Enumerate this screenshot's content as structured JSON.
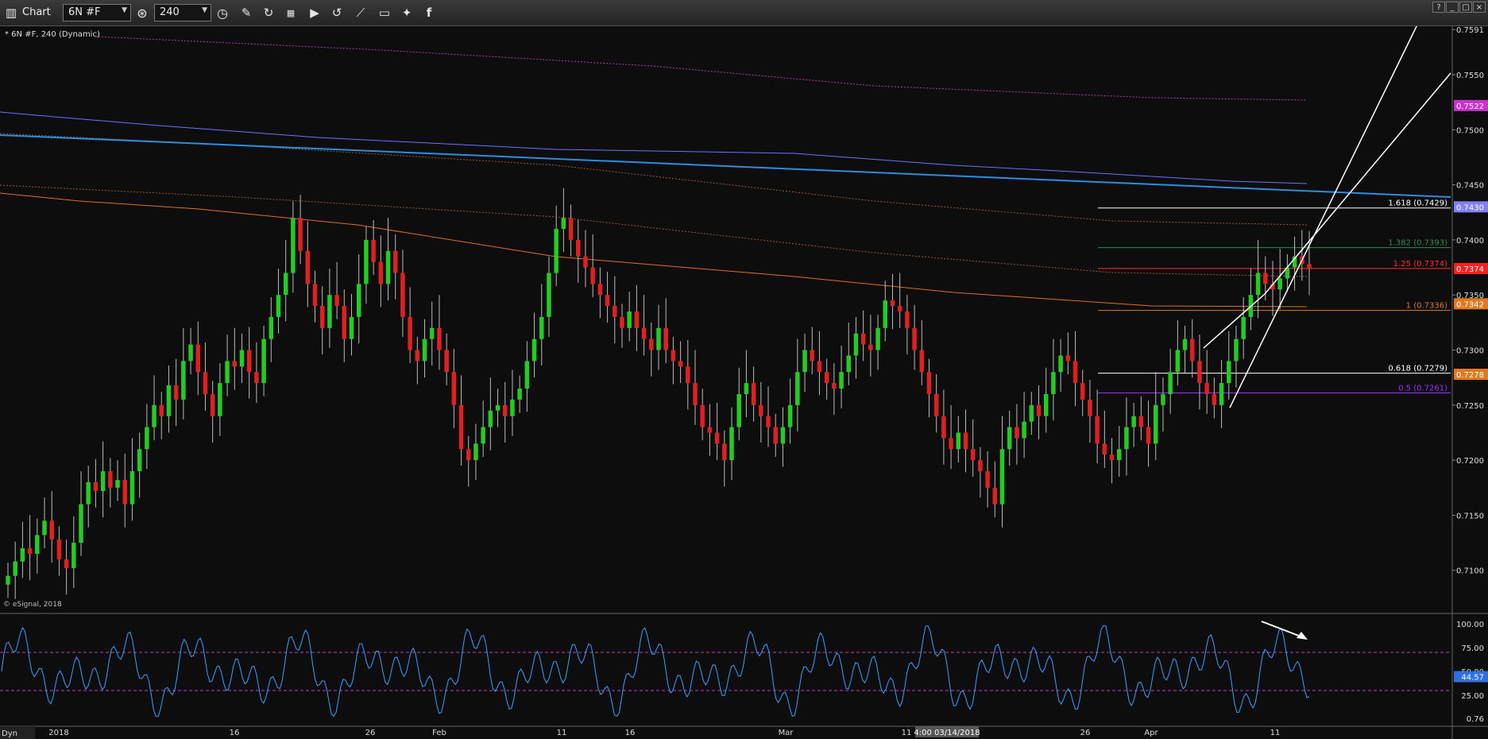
{
  "toolbar": {
    "title": "Chart",
    "symbol": "6N #F",
    "interval": "240",
    "icons": [
      "chart-app-icon",
      "symbol-lookup-icon",
      "interval-clock-icon",
      "draw-pen-icon",
      "refresh-icon",
      "settings-icon",
      "play-icon",
      "replay-icon",
      "ruler-icon",
      "comment-icon",
      "twitter-icon",
      "facebook-icon"
    ],
    "window_buttons": [
      "?",
      "_",
      "□",
      "×"
    ]
  },
  "chart_data": [
    {
      "type": "line",
      "label": "* 6N #F, 240 (Dynamic)",
      "series_name": "6N #F",
      "interval": "240",
      "copyright": "© eSignal, 2018",
      "y_ticks": [
        0.7591,
        0.755,
        0.75,
        0.745,
        0.74,
        0.735,
        0.73,
        0.725,
        0.72,
        0.715,
        0.71
      ],
      "y_tick_labels": [
        "0.7591",
        "0.7550",
        "0.7500",
        "0.7450",
        "0.7400",
        "0.7350",
        "0.7300",
        "0.7250",
        "0.7200",
        "0.7150",
        "0.7100"
      ],
      "ylim": [
        0.7063,
        0.7594
      ],
      "price_badges": [
        {
          "label": "0.7522",
          "color": "#cc33cc"
        },
        {
          "label": "0.7430",
          "color": "#8080ff"
        },
        {
          "label": "0.7374",
          "color": "#ff2020"
        },
        {
          "label": "0.7342",
          "color": "#e07a20"
        },
        {
          "label": "0.7278",
          "color": "#e07a20"
        }
      ],
      "fib_levels": [
        {
          "label": "1.618 (0.7429)",
          "value": 0.7429,
          "color": "#ffffff"
        },
        {
          "label": "1.382 (0.7393)",
          "value": 0.7393,
          "color": "#2e8b57"
        },
        {
          "label": "1.25 (0.7374)",
          "value": 0.7374,
          "color": "#ff3030"
        },
        {
          "label": "1 (0.7336)",
          "value": 0.7336,
          "color": "#e07a20"
        },
        {
          "label": "0.618 (0.7279)",
          "value": 0.7279,
          "color": "#ffffff"
        },
        {
          "label": "0.5 (0.7261)",
          "value": 0.7261,
          "color": "#9933ff"
        }
      ],
      "closes": [
        0.7095,
        0.7108,
        0.712,
        0.7115,
        0.7132,
        0.7145,
        0.7128,
        0.711,
        0.7102,
        0.7125,
        0.716,
        0.718,
        0.7172,
        0.719,
        0.7175,
        0.7182,
        0.716,
        0.719,
        0.721,
        0.723,
        0.725,
        0.724,
        0.7268,
        0.7255,
        0.729,
        0.7305,
        0.728,
        0.726,
        0.724,
        0.727,
        0.729,
        0.7285,
        0.73,
        0.728,
        0.727,
        0.731,
        0.733,
        0.735,
        0.737,
        0.742,
        0.739,
        0.736,
        0.734,
        0.732,
        0.735,
        0.734,
        0.731,
        0.733,
        0.736,
        0.74,
        0.738,
        0.736,
        0.739,
        0.737,
        0.733,
        0.73,
        0.729,
        0.731,
        0.732,
        0.73,
        0.728,
        0.725,
        0.721,
        0.72,
        0.7215,
        0.723,
        0.7245,
        0.725,
        0.724,
        0.7255,
        0.7265,
        0.729,
        0.731,
        0.733,
        0.737,
        0.741,
        0.742,
        0.74,
        0.7385,
        0.7375,
        0.736,
        0.735,
        0.734,
        0.733,
        0.732,
        0.7335,
        0.732,
        0.731,
        0.73,
        0.732,
        0.73,
        0.729,
        0.7285,
        0.727,
        0.725,
        0.723,
        0.7225,
        0.7215,
        0.72,
        0.723,
        0.726,
        0.727,
        0.725,
        0.724,
        0.723,
        0.7215,
        0.723,
        0.725,
        0.728,
        0.73,
        0.729,
        0.728,
        0.727,
        0.7265,
        0.728,
        0.7295,
        0.7315,
        0.7305,
        0.73,
        0.732,
        0.7345,
        0.734,
        0.7335,
        0.732,
        0.73,
        0.728,
        0.726,
        0.724,
        0.722,
        0.721,
        0.7225,
        0.721,
        0.72,
        0.719,
        0.7175,
        0.716,
        0.721,
        0.723,
        0.722,
        0.7235,
        0.725,
        0.724,
        0.726,
        0.728,
        0.7295,
        0.729,
        0.727,
        0.7255,
        0.724,
        0.7215,
        0.7205,
        0.72,
        0.721,
        0.723,
        0.724,
        0.723,
        0.7215,
        0.725,
        0.726,
        0.728,
        0.73,
        0.731,
        0.729,
        0.727,
        0.726,
        0.725,
        0.727,
        0.729,
        0.731,
        0.733,
        0.735,
        0.737,
        0.736,
        0.7355,
        0.7365,
        0.7375,
        0.7385,
        0.7378,
        0.7374
      ],
      "oscillator": {
        "type": "line",
        "y_ticks": [
          100.0,
          75.0,
          50.0,
          25.0,
          0.76
        ],
        "y_tick_labels": [
          "100.00",
          "75.00",
          "50.00",
          "25.00",
          "0.76"
        ],
        "levels": [
          70,
          30
        ],
        "current_value_label": "44.57",
        "current_value": 44.57
      },
      "x_tick_labels": [
        "2018",
        "16",
        "26",
        "Feb",
        "11",
        "16",
        "Mar",
        "11",
        "26",
        "Apr",
        "11"
      ],
      "crosshair_time_label": "4:00 03/14/2018",
      "status_label": "Dyn"
    }
  ],
  "colors": {
    "background": "#0d0d0d",
    "bull": "#22cc22",
    "bear": "#e02020",
    "trendline": "#2a8fe0",
    "oscillator": "#3aa0ff"
  }
}
